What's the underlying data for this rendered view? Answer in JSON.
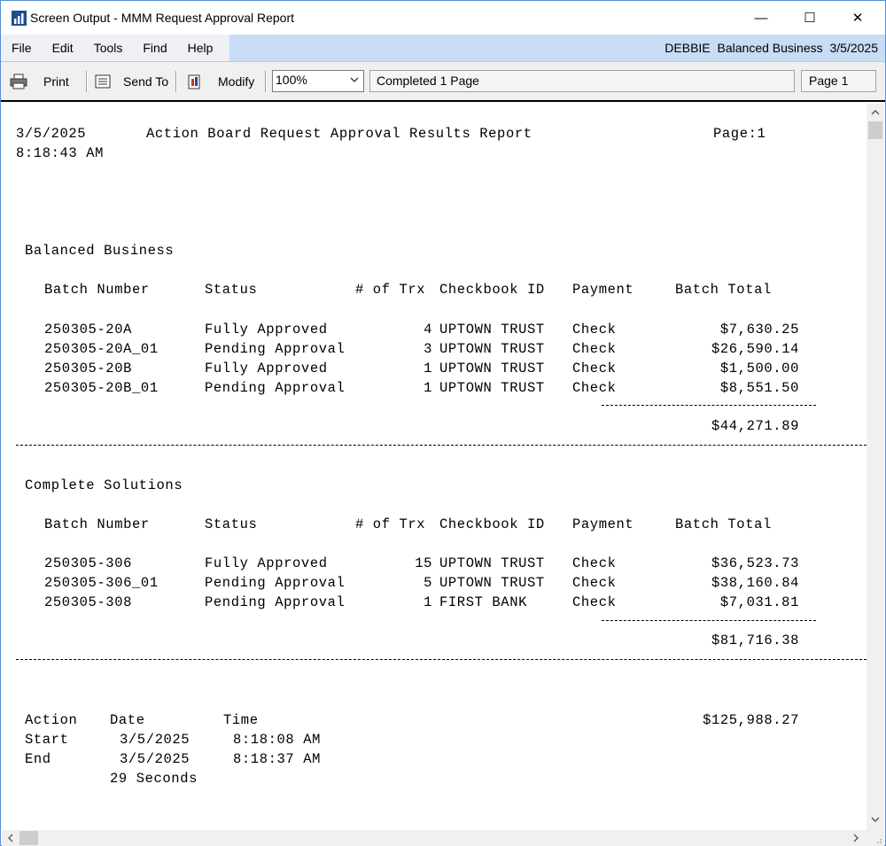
{
  "window": {
    "title": "Screen Output - MMM Request Approval Report",
    "minimize_glyph": "—",
    "maximize_glyph": "☐",
    "close_glyph": "✕"
  },
  "menu": {
    "items": [
      "File",
      "Edit",
      "Tools",
      "Find",
      "Help"
    ],
    "user": "DEBBIE",
    "company": "Balanced Business",
    "date": "3/5/2025"
  },
  "toolbar": {
    "print_label": "Print",
    "send_to_label": "Send To",
    "modify_label": "Modify",
    "zoom_value": "100%",
    "status_text": "Completed 1 Page",
    "page_text": "Page 1"
  },
  "report": {
    "header": {
      "date": "3/5/2025",
      "time": "8:18:43 AM",
      "title": "Action Board Request Approval Results Report",
      "page": "Page:1"
    },
    "columns": {
      "batch": "Batch Number",
      "status": "Status",
      "trx": "# of Trx",
      "checkbook": "Checkbook ID",
      "payment": "Payment",
      "total": "Batch Total"
    },
    "companies": [
      {
        "name": "Balanced Business",
        "rows": [
          {
            "batch": "250305-20A",
            "status": "Fully Approved",
            "trx": "4",
            "checkbook": "UPTOWN TRUST",
            "payment": "Check",
            "total": "$7,630.25"
          },
          {
            "batch": "250305-20A_01",
            "status": "Pending Approval",
            "trx": "3",
            "checkbook": "UPTOWN TRUST",
            "payment": "Check",
            "total": "$26,590.14"
          },
          {
            "batch": "250305-20B",
            "status": "Fully Approved",
            "trx": "1",
            "checkbook": "UPTOWN TRUST",
            "payment": "Check",
            "total": "$1,500.00"
          },
          {
            "batch": "250305-20B_01",
            "status": "Pending Approval",
            "trx": "1",
            "checkbook": "UPTOWN TRUST",
            "payment": "Check",
            "total": "$8,551.50"
          }
        ],
        "subtotal": "$44,271.89"
      },
      {
        "name": "Complete Solutions",
        "rows": [
          {
            "batch": "250305-306",
            "status": "Fully Approved",
            "trx": "15",
            "checkbook": "UPTOWN TRUST",
            "payment": "Check",
            "total": "$36,523.73"
          },
          {
            "batch": "250305-306_01",
            "status": "Pending Approval",
            "trx": "5",
            "checkbook": "UPTOWN TRUST",
            "payment": "Check",
            "total": "$38,160.84"
          },
          {
            "batch": "250305-308",
            "status": "Pending Approval",
            "trx": "1",
            "checkbook": "FIRST BANK",
            "payment": "Check",
            "total": "$7,031.81"
          }
        ],
        "subtotal": "$81,716.38"
      }
    ],
    "footer": {
      "action_header": "Action",
      "date_header": "Date",
      "time_header": "Time",
      "grand_total": "$125,988.27",
      "start_label": "Start",
      "start_date": "3/5/2025",
      "start_time": "8:18:08 AM",
      "end_label": "End",
      "end_date": "3/5/2025",
      "end_time": "8:18:37 AM",
      "duration": "29 Seconds"
    }
  }
}
